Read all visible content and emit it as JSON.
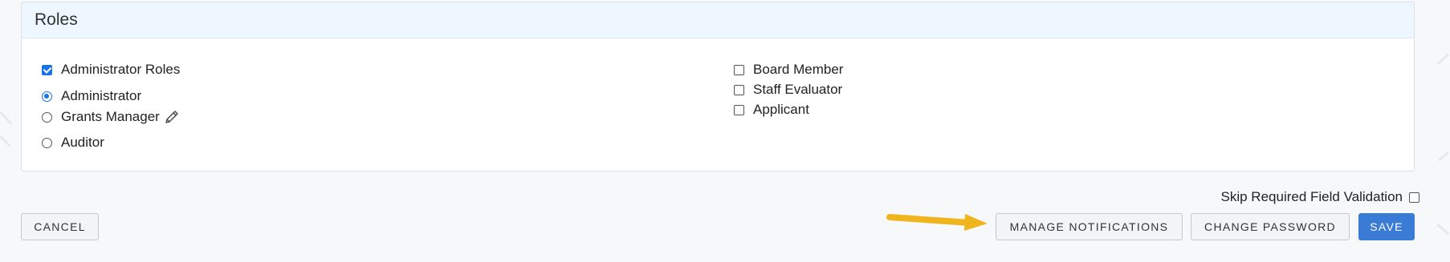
{
  "roles_card": {
    "title": "Roles",
    "admin_group": {
      "label": "Administrator Roles",
      "checked": true,
      "options": [
        {
          "label": "Administrator",
          "selected": true
        },
        {
          "label": "Grants Manager",
          "selected": false,
          "icon": "pencil-icon"
        },
        {
          "label": "Auditor",
          "selected": false
        }
      ]
    },
    "other_roles": [
      {
        "label": "Board Member",
        "checked": false
      },
      {
        "label": "Staff Evaluator",
        "checked": false
      },
      {
        "label": "Applicant",
        "checked": false
      }
    ]
  },
  "skip_validation": {
    "label": "Skip Required Field Validation",
    "checked": false
  },
  "buttons": {
    "cancel": "CANCEL",
    "manage_notifications": "MANAGE NOTIFICATIONS",
    "change_password": "CHANGE PASSWORD",
    "save": "SAVE"
  },
  "colors": {
    "accent": "#3a7bd5",
    "header_bg": "#eef6ff",
    "annotation_arrow": "#f0b41c"
  }
}
